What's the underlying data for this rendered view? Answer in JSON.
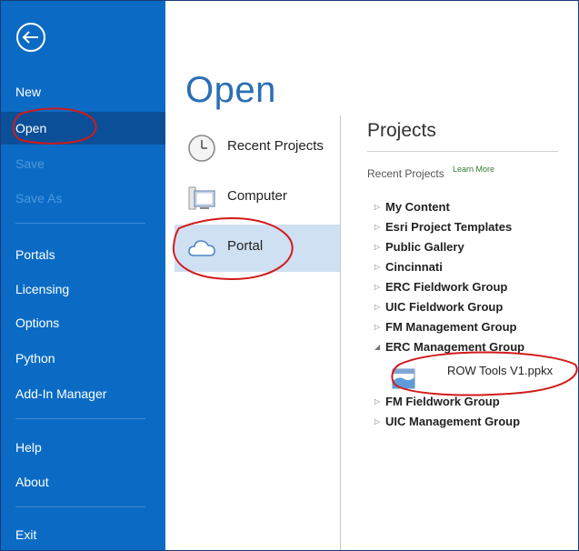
{
  "sidebar": {
    "back_icon": "back-arrow-icon",
    "items": [
      {
        "label": "New",
        "state": "normal"
      },
      {
        "label": "Open",
        "state": "selected"
      },
      {
        "label": "Save",
        "state": "disabled"
      },
      {
        "label": "Save As",
        "state": "disabled"
      },
      {
        "label": "Portals",
        "state": "normal"
      },
      {
        "label": "Licensing",
        "state": "normal"
      },
      {
        "label": "Options",
        "state": "normal"
      },
      {
        "label": "Python",
        "state": "normal"
      },
      {
        "label": "Add-In Manager",
        "state": "normal"
      },
      {
        "label": "Help",
        "state": "normal"
      },
      {
        "label": "About",
        "state": "normal"
      },
      {
        "label": "Exit",
        "state": "normal"
      }
    ]
  },
  "main": {
    "title": "Open",
    "locations": [
      {
        "label": "Recent Projects",
        "icon": "clock-icon"
      },
      {
        "label": "Computer",
        "icon": "computer-icon"
      },
      {
        "label": "Portal",
        "icon": "cloud-icon",
        "selected": true
      }
    ]
  },
  "projects": {
    "title": "Projects",
    "recent_label": "Recent Projects",
    "learn_more": "Learn More",
    "tree": [
      {
        "label": "My Content",
        "expanded": false
      },
      {
        "label": "Esri Project Templates",
        "expanded": false
      },
      {
        "label": "Public Gallery",
        "expanded": false
      },
      {
        "label": "Cincinnati",
        "expanded": false
      },
      {
        "label": "ERC Fieldwork Group",
        "expanded": false
      },
      {
        "label": "UIC Fieldwork Group",
        "expanded": false
      },
      {
        "label": "FM Management Group",
        "expanded": false
      },
      {
        "label": "ERC Management Group",
        "expanded": true
      },
      {
        "label": "FM Fieldwork Group",
        "expanded": false
      },
      {
        "label": "UIC Management Group",
        "expanded": false
      }
    ],
    "file": {
      "label": "ROW Tools V1.ppkx",
      "icon": "project-file-icon"
    }
  },
  "colors": {
    "sidebar_bg": "#0b6bc4",
    "sidebar_selected": "#0a4f98",
    "title_blue": "#2b6fb3",
    "portal_selected_bg": "#cfe0f2",
    "annotation_red": "#d21a1a"
  }
}
